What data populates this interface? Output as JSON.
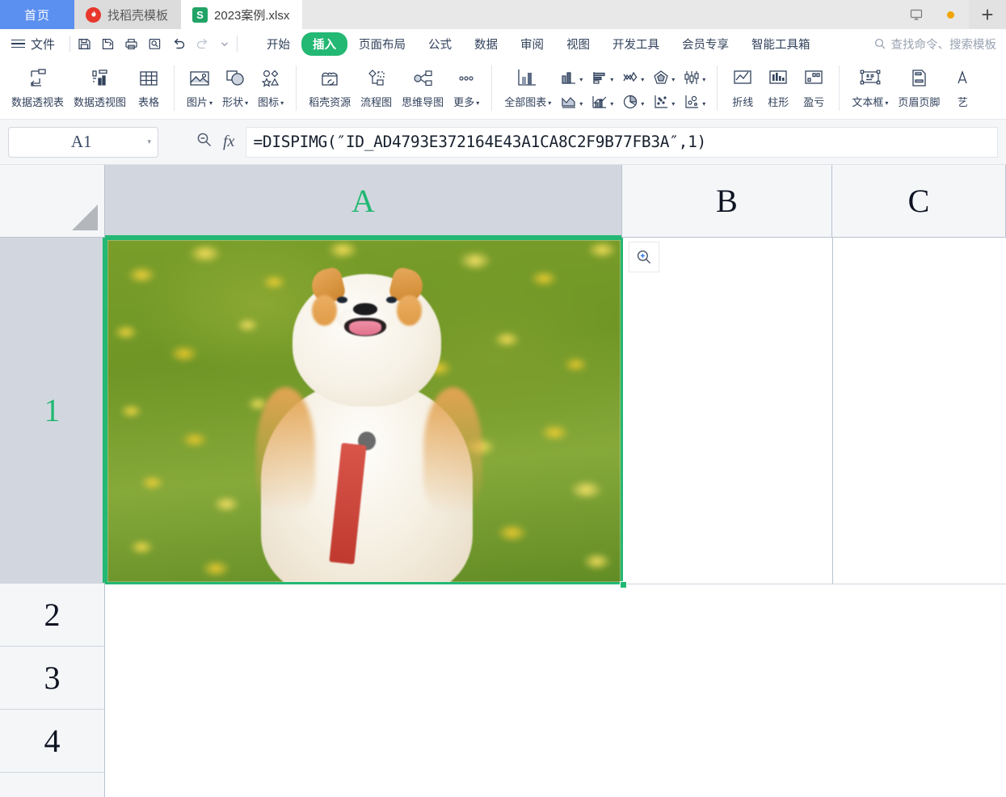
{
  "window": {
    "home_tab_label": "首页",
    "tabs": [
      {
        "label": "找稻壳模板",
        "icon": "docer-icon",
        "active": false
      },
      {
        "label": "2023案例.xlsx",
        "icon": "spreadsheet-icon",
        "active": true
      }
    ],
    "monitor_icon": "monitor-icon",
    "new_tab_label": "+"
  },
  "menubar": {
    "file_label": "文件",
    "quick_access": [
      {
        "name": "save-icon"
      },
      {
        "name": "save-as-icon"
      },
      {
        "name": "print-icon"
      },
      {
        "name": "print-preview-icon"
      },
      {
        "name": "undo-icon"
      },
      {
        "name": "redo-icon"
      },
      {
        "name": "customize-toolbar-caret"
      }
    ],
    "ribbon_tabs": [
      {
        "label": "开始",
        "active": false
      },
      {
        "label": "插入",
        "active": true
      },
      {
        "label": "页面布局",
        "active": false
      },
      {
        "label": "公式",
        "active": false
      },
      {
        "label": "数据",
        "active": false
      },
      {
        "label": "审阅",
        "active": false
      },
      {
        "label": "视图",
        "active": false
      },
      {
        "label": "开发工具",
        "active": false
      },
      {
        "label": "会员专享",
        "active": false
      },
      {
        "label": "智能工具箱",
        "active": false
      }
    ],
    "search_placeholder": "查找命令、搜索模板",
    "accent_color": "#23b873"
  },
  "ribbon": {
    "group1": [
      {
        "label": "数据透视表",
        "icon": "pivot-table-icon",
        "caret": false
      },
      {
        "label": "数据透视图",
        "icon": "pivot-chart-icon",
        "caret": false
      },
      {
        "label": "表格",
        "icon": "table-icon",
        "caret": false
      }
    ],
    "group2": [
      {
        "label": "图片",
        "icon": "picture-icon",
        "caret": true
      },
      {
        "label": "形状",
        "icon": "shapes-icon",
        "caret": true
      },
      {
        "label": "图标",
        "icon": "icons-icon",
        "caret": true
      }
    ],
    "group3": [
      {
        "label": "稻壳资源",
        "icon": "docer-resource-icon",
        "caret": false
      },
      {
        "label": "流程图",
        "icon": "flowchart-icon",
        "caret": false
      },
      {
        "label": "思维导图",
        "icon": "mindmap-icon",
        "caret": false
      },
      {
        "label": "更多",
        "icon": "more-icon",
        "caret": true
      }
    ],
    "group4": [
      {
        "label": "全部图表",
        "icon": "all-charts-icon",
        "caret": true
      }
    ],
    "chart_icons": [
      {
        "name": "column-chart-icon"
      },
      {
        "name": "bar-chart-icon"
      },
      {
        "name": "stock-chart-icon"
      },
      {
        "name": "radar-chart-icon"
      },
      {
        "name": "box-plot-icon"
      },
      {
        "name": "area-chart-icon"
      },
      {
        "name": "combo-chart-icon"
      },
      {
        "name": "pie-chart-icon"
      },
      {
        "name": "scatter-chart-icon"
      },
      {
        "name": "bubble-chart-icon"
      }
    ],
    "group5": [
      {
        "label": "折线",
        "icon": "sparkline-line-icon",
        "caret": false
      },
      {
        "label": "柱形",
        "icon": "sparkline-column-icon",
        "caret": false
      },
      {
        "label": "盈亏",
        "icon": "sparkline-winloss-icon",
        "caret": false
      }
    ],
    "group6": [
      {
        "label": "文本框",
        "icon": "textbox-icon",
        "caret": true
      },
      {
        "label": "页眉页脚",
        "icon": "header-footer-icon",
        "caret": false
      },
      {
        "label": "艺",
        "icon": "wordart-icon",
        "caret": false
      }
    ]
  },
  "formula_bar": {
    "name_box_value": "A1",
    "zoom_icon": "zoom-out-icon",
    "fx_label": "fx",
    "formula": "=DISPIMG(″ID_AD4793E372164E43A1CA8C2F9B77FB3A″,1)"
  },
  "grid": {
    "select_all_icon": "select-all-corner",
    "columns": [
      {
        "label": "A",
        "selected": true
      },
      {
        "label": "B",
        "selected": false
      },
      {
        "label": "C",
        "selected": false
      }
    ],
    "rows": [
      {
        "label": "1",
        "selected": true
      },
      {
        "label": "2",
        "selected": false
      },
      {
        "label": "3",
        "selected": false
      },
      {
        "label": "4",
        "selected": false
      }
    ],
    "selected_cell": "A1",
    "cell_a1_content": "embedded-image-corgi-dog-in-yellow-flower-field",
    "image_zoom_button_icon": "zoom-in-icon",
    "selection_color": "#23b873"
  }
}
